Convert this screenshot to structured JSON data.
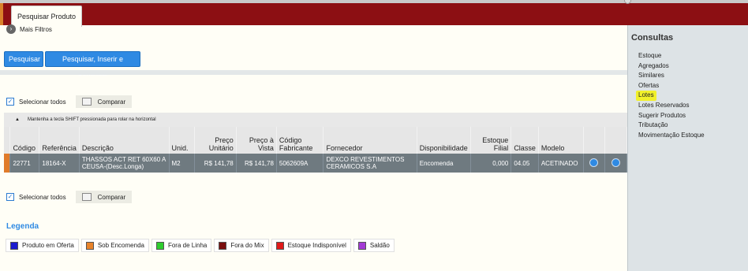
{
  "tab": {
    "label": "Pesquisar Produto"
  },
  "filters": {
    "more_label": "Mais Filtros"
  },
  "buttons": {
    "search": "Pesquisar",
    "search_insert": "Pesquisar, Inserir e Continuar"
  },
  "select_all": "Selecionar todos",
  "compare": "Comparar",
  "table": {
    "shift_hint": "Mantenha a tecla SHIFT pressionada para rolar na horizontal",
    "headers": [
      "Código",
      "Referência",
      "Descrição",
      "Unid.",
      "Preço Unitário",
      "Preço à Vista",
      "Código Fabricante",
      "Fornecedor",
      "Disponibilidade",
      "Estoque Filial",
      "Classe",
      "Modelo"
    ],
    "rows": [
      {
        "codigo": "22771",
        "referencia": "18164-X",
        "descricao": "THASSOS ACT RET 60X60 A CEUSA-(Desc.Longa)",
        "unid": "M2",
        "preco_unitario": "R$ 141,78",
        "preco_vista": "R$ 141,78",
        "codigo_fabricante": "5062609A",
        "fornecedor": "DEXCO REVESTIMENTOS CERAMICOS S.A",
        "disponibilidade": "Encomenda",
        "estoque_filial": "0,000",
        "classe": "04.05",
        "modelo": "ACETINADO"
      }
    ]
  },
  "legend": {
    "title": "Legenda",
    "items": [
      {
        "label": "Produto em Oferta",
        "color": "#1a1acf"
      },
      {
        "label": "Sob Encomenda",
        "color": "#e8832a"
      },
      {
        "label": "Fora de Linha",
        "color": "#2ecc2e"
      },
      {
        "label": "Fora do Mix",
        "color": "#7a0f0f"
      },
      {
        "label": "Estoque Indisponível",
        "color": "#e01a1a"
      },
      {
        "label": "Saldão",
        "color": "#a33ad6"
      }
    ]
  },
  "consultas": {
    "title": "Consultas",
    "links": [
      "Estoque",
      "Agregados",
      "Similares",
      "Ofertas",
      "Lotes",
      "Lotes Reservados",
      "Sugerir Produtos",
      "Tributação",
      "Movimentação Estoque"
    ]
  },
  "colors": {
    "topbar": "#8c0f13",
    "button": "#2f8ae3",
    "row": "#6f7a80",
    "highlight": "#f1f02b"
  }
}
